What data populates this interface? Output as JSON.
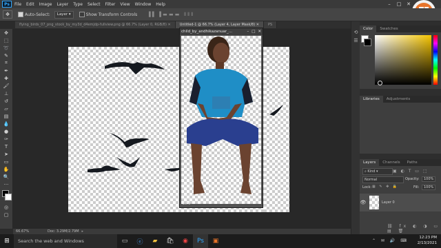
{
  "app": {
    "logo_text": "Ps",
    "menu": [
      "File",
      "Edit",
      "Image",
      "Layer",
      "Type",
      "Select",
      "Filter",
      "View",
      "Window",
      "Help"
    ],
    "window_controls": [
      "–",
      "□",
      "✕"
    ]
  },
  "options": {
    "auto_select_label": "Auto-Select:",
    "auto_select_value": "Layer",
    "transform_label": "Show Transform Controls"
  },
  "doc_tabs": [
    {
      "label": "flying_birds_07_png_stock_by_my3d_d4emjdp-fullview.png @ 66.7% (Layer 0, RGB/8)",
      "active": false
    },
    {
      "label": "Untitled-1 @ 66.7% (Layer 4, Layer Mask/8)",
      "active": true
    },
    {
      "label": "PS",
      "active": false
    }
  ],
  "float_window": {
    "title": "child_by_andhikazanuar_...",
    "zoom": "25%"
  },
  "status": {
    "zoom": "66.67%",
    "doc": "Doc: 3.29M/2.79M"
  },
  "panels": {
    "color_tabs": [
      "Color",
      "Swatches"
    ],
    "lib_tabs": [
      "Libraries",
      "Adjustments"
    ],
    "layer_tabs": [
      "Layers",
      "Channels",
      "Paths"
    ],
    "kind_label": "Kind",
    "blend_mode": "Normal",
    "opacity_label": "Opacity:",
    "opacity_value": "100%",
    "lock_label": "Lock:",
    "fill_label": "Fill:",
    "fill_value": "100%",
    "layer_name": "Layer 0"
  },
  "taskbar": {
    "search_placeholder": "Search the web and Windows",
    "time": "12:23 PM",
    "date": "2/13/2021"
  },
  "colors": {
    "accent": "#31a8ff",
    "brand_orange": "#e8742a",
    "panel": "#3e3e3e"
  }
}
